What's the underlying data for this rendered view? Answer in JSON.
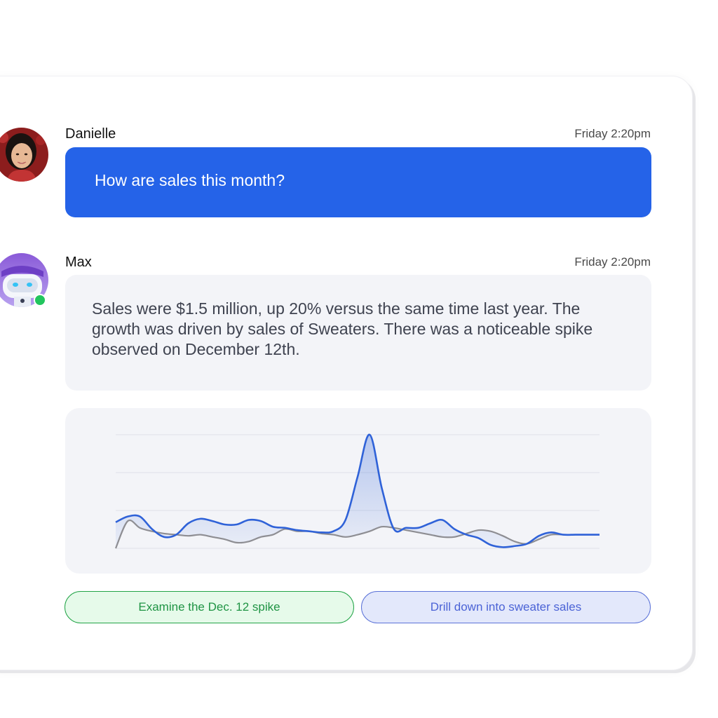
{
  "conversation": {
    "messages": [
      {
        "sender": "Danielle",
        "timestamp": "Friday 2:20pm",
        "text": "How are sales this month?"
      },
      {
        "sender": "Max",
        "timestamp": "Friday 2:20pm",
        "text": "Sales were $1.5 million, up 20% versus the same time last year. The growth was driven by sales of Sweaters. There was a noticeable spike observed on December 12th."
      }
    ],
    "suggestions": [
      {
        "label": "Examine the Dec. 12 spike"
      },
      {
        "label": "Drill down into sweater sales"
      }
    ]
  },
  "colors": {
    "user_bubble": "#2563e8",
    "primary_series": "#2f62d8",
    "secondary_series": "#8e8e93",
    "online_status": "#22c55e"
  },
  "chart_data": {
    "type": "area",
    "title": "",
    "xlabel": "",
    "ylabel": "",
    "grid": true,
    "ylim": [
      0,
      100
    ],
    "x": [
      0,
      3,
      6,
      9,
      12,
      15,
      18,
      21,
      24,
      27,
      30,
      33,
      36,
      39,
      42,
      45,
      48,
      51,
      54,
      57,
      60,
      63,
      66,
      69,
      72,
      75,
      78,
      81,
      84,
      87,
      90,
      93,
      96,
      99,
      102,
      105,
      108,
      111,
      114,
      117,
      120
    ],
    "series": [
      {
        "values": [
          23,
          28,
          28,
          17,
          10,
          12,
          22,
          26,
          24,
          21,
          21,
          25,
          24,
          19,
          18,
          16,
          15,
          14,
          15,
          25,
          63,
          100,
          53,
          17,
          18,
          18,
          22,
          25,
          17,
          12,
          9,
          3,
          1,
          2,
          4,
          11,
          14,
          12,
          12,
          12,
          12
        ]
      },
      {
        "values": [
          0,
          24,
          18,
          15,
          13,
          12,
          11,
          12,
          10,
          8,
          5,
          6,
          10,
          12,
          17,
          15,
          15,
          13,
          12,
          10,
          12,
          15,
          19,
          18,
          16,
          14,
          12,
          10,
          10,
          13,
          16,
          15,
          11,
          6,
          4,
          8,
          12,
          12,
          12,
          12,
          12
        ]
      }
    ]
  }
}
